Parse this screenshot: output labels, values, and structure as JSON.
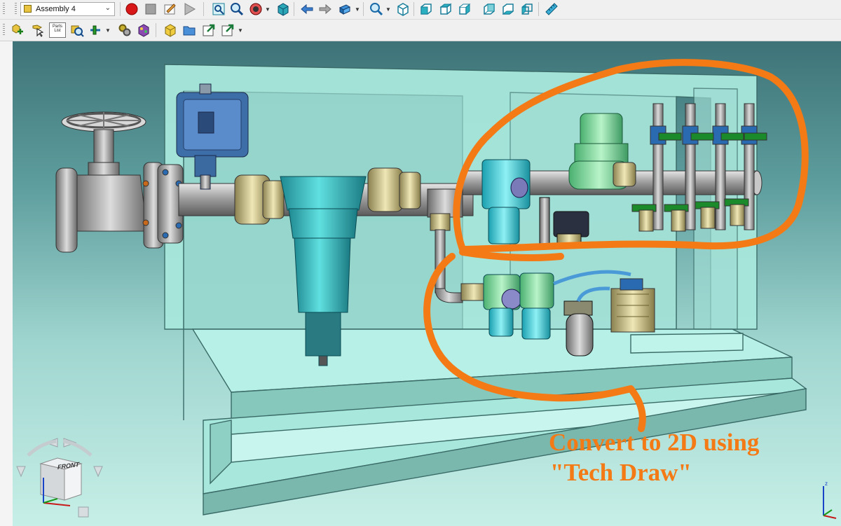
{
  "toolbar": {
    "assembly_combo": {
      "value": "Assembly 4"
    },
    "row1_icons": [
      "record-macro-icon",
      "stop-macro-icon",
      "macro-editor-icon",
      "run-macro-icon",
      "fit-all-icon",
      "fit-selection-icon",
      "draw-style-icon",
      "bounding-box-icon",
      "back-icon",
      "forward-icon",
      "sync-view-icon",
      "zoom-icon",
      "isometric-view-icon",
      "front-view-icon",
      "top-view-icon",
      "right-view-icon",
      "rear-view-icon",
      "bottom-view-icon",
      "left-view-icon",
      "measure-icon"
    ],
    "row2_icons": [
      "add-part-icon",
      "select-icon",
      "parts-list-icon",
      "measure-assembly-icon",
      "insert-link-icon",
      "solve-assembly-icon",
      "animate-icon",
      "variables-icon",
      "new-part-icon",
      "open-folder-icon",
      "export-icon",
      "export-dropdown-icon"
    ],
    "parts_list_label": "Parts List"
  },
  "annotation": {
    "line1": "Convert to 2D using",
    "line2": "\"Tech Draw\"",
    "color": "#f47a16"
  },
  "navigation_cube": {
    "face_label": "FRONT"
  },
  "colors": {
    "frame": "#a8e8dc",
    "piping": "#a7a7a7",
    "filter": "#40c8c8",
    "valve": "#8ee6a8",
    "fitting_brass": "#d2c88a",
    "junction_box": "#3e6ea8"
  }
}
